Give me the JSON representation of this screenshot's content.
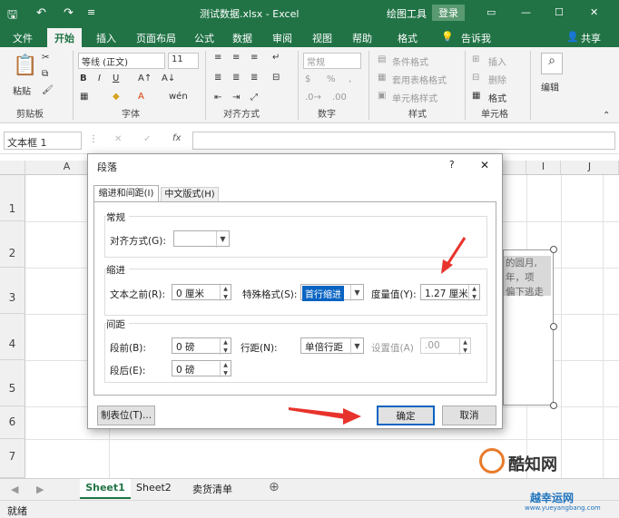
{
  "window": {
    "title": "测试数据.xlsx - Excel",
    "drawing_tools": "绘图工具",
    "login": "登录"
  },
  "tabs": [
    "文件",
    "开始",
    "插入",
    "页面布局",
    "公式",
    "数据",
    "审阅",
    "视图",
    "帮助",
    "格式",
    "告诉我",
    "共享"
  ],
  "ribbon": {
    "clipboard": {
      "paste": "粘贴",
      "group": "剪贴板"
    },
    "font": {
      "name": "等线 (正文)",
      "size": "11",
      "group": "字体",
      "wen": "wén"
    },
    "alignment": {
      "group": "对齐方式"
    },
    "number": {
      "format": "常规",
      "group": "数字",
      "pct": "%"
    },
    "styles": {
      "cond": "条件格式",
      "table": "套用表格格式",
      "cell": "单元格样式",
      "group": "样式"
    },
    "cells": {
      "insert": "插入",
      "delete": "删除",
      "format": "格式",
      "group": "单元格"
    },
    "editing": {
      "label": "编辑"
    }
  },
  "formula_bar": {
    "name_box": "文本框 1",
    "fx": "fx"
  },
  "columns": [
    "A",
    "I",
    "J"
  ],
  "rows": [
    "1",
    "2",
    "3",
    "4",
    "5",
    "6",
    "7"
  ],
  "textbox_fragments": [
    "的圆月,",
    "年，项",
    "偏下逃走"
  ],
  "sheets": [
    "Sheet1",
    "Sheet2",
    "卖货清单"
  ],
  "status": {
    "text": "就绪"
  },
  "watermark": {
    "brand": "酷知网",
    "site_name": "越幸运网",
    "url": "www.yueyangbang.com"
  },
  "dialog": {
    "title": "段落",
    "help": "?",
    "close": "✕",
    "tabs": [
      "缩进和间距(I)",
      "中文版式(H)"
    ],
    "general": {
      "title": "常规",
      "align_label": "对齐方式(G):",
      "align_value": ""
    },
    "indent": {
      "title": "缩进",
      "before_label": "文本之前(R):",
      "before_value": "0 厘米",
      "special_label": "特殊格式(S):",
      "special_value": "首行缩进",
      "measure_label": "度量值(Y):",
      "measure_value": "1.27 厘米"
    },
    "spacing": {
      "title": "间距",
      "before_label": "段前(B):",
      "before_value": "0 磅",
      "after_label": "段后(E):",
      "after_value": "0 磅",
      "line_label": "行距(N):",
      "line_value": "单倍行距",
      "setting_label": "设置值(A)",
      "setting_value": ".00"
    },
    "tabs_button": "制表位(T)...",
    "ok": "确定",
    "cancel": "取消"
  }
}
